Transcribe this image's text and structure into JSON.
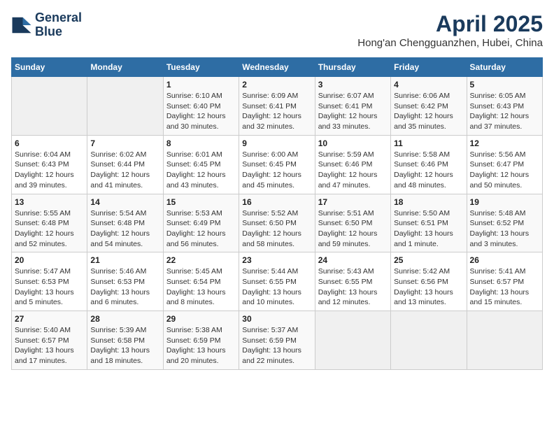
{
  "header": {
    "logo_line1": "General",
    "logo_line2": "Blue",
    "month": "April 2025",
    "location": "Hong'an Chengguanzhen, Hubei, China"
  },
  "days_of_week": [
    "Sunday",
    "Monday",
    "Tuesday",
    "Wednesday",
    "Thursday",
    "Friday",
    "Saturday"
  ],
  "weeks": [
    [
      {
        "day": "",
        "empty": true
      },
      {
        "day": "",
        "empty": true
      },
      {
        "day": "1",
        "info": "Sunrise: 6:10 AM\nSunset: 6:40 PM\nDaylight: 12 hours\nand 30 minutes."
      },
      {
        "day": "2",
        "info": "Sunrise: 6:09 AM\nSunset: 6:41 PM\nDaylight: 12 hours\nand 32 minutes."
      },
      {
        "day": "3",
        "info": "Sunrise: 6:07 AM\nSunset: 6:41 PM\nDaylight: 12 hours\nand 33 minutes."
      },
      {
        "day": "4",
        "info": "Sunrise: 6:06 AM\nSunset: 6:42 PM\nDaylight: 12 hours\nand 35 minutes."
      },
      {
        "day": "5",
        "info": "Sunrise: 6:05 AM\nSunset: 6:43 PM\nDaylight: 12 hours\nand 37 minutes."
      }
    ],
    [
      {
        "day": "6",
        "info": "Sunrise: 6:04 AM\nSunset: 6:43 PM\nDaylight: 12 hours\nand 39 minutes."
      },
      {
        "day": "7",
        "info": "Sunrise: 6:02 AM\nSunset: 6:44 PM\nDaylight: 12 hours\nand 41 minutes."
      },
      {
        "day": "8",
        "info": "Sunrise: 6:01 AM\nSunset: 6:45 PM\nDaylight: 12 hours\nand 43 minutes."
      },
      {
        "day": "9",
        "info": "Sunrise: 6:00 AM\nSunset: 6:45 PM\nDaylight: 12 hours\nand 45 minutes."
      },
      {
        "day": "10",
        "info": "Sunrise: 5:59 AM\nSunset: 6:46 PM\nDaylight: 12 hours\nand 47 minutes."
      },
      {
        "day": "11",
        "info": "Sunrise: 5:58 AM\nSunset: 6:46 PM\nDaylight: 12 hours\nand 48 minutes."
      },
      {
        "day": "12",
        "info": "Sunrise: 5:56 AM\nSunset: 6:47 PM\nDaylight: 12 hours\nand 50 minutes."
      }
    ],
    [
      {
        "day": "13",
        "info": "Sunrise: 5:55 AM\nSunset: 6:48 PM\nDaylight: 12 hours\nand 52 minutes."
      },
      {
        "day": "14",
        "info": "Sunrise: 5:54 AM\nSunset: 6:48 PM\nDaylight: 12 hours\nand 54 minutes."
      },
      {
        "day": "15",
        "info": "Sunrise: 5:53 AM\nSunset: 6:49 PM\nDaylight: 12 hours\nand 56 minutes."
      },
      {
        "day": "16",
        "info": "Sunrise: 5:52 AM\nSunset: 6:50 PM\nDaylight: 12 hours\nand 58 minutes."
      },
      {
        "day": "17",
        "info": "Sunrise: 5:51 AM\nSunset: 6:50 PM\nDaylight: 12 hours\nand 59 minutes."
      },
      {
        "day": "18",
        "info": "Sunrise: 5:50 AM\nSunset: 6:51 PM\nDaylight: 13 hours\nand 1 minute."
      },
      {
        "day": "19",
        "info": "Sunrise: 5:48 AM\nSunset: 6:52 PM\nDaylight: 13 hours\nand 3 minutes."
      }
    ],
    [
      {
        "day": "20",
        "info": "Sunrise: 5:47 AM\nSunset: 6:53 PM\nDaylight: 13 hours\nand 5 minutes."
      },
      {
        "day": "21",
        "info": "Sunrise: 5:46 AM\nSunset: 6:53 PM\nDaylight: 13 hours\nand 6 minutes."
      },
      {
        "day": "22",
        "info": "Sunrise: 5:45 AM\nSunset: 6:54 PM\nDaylight: 13 hours\nand 8 minutes."
      },
      {
        "day": "23",
        "info": "Sunrise: 5:44 AM\nSunset: 6:55 PM\nDaylight: 13 hours\nand 10 minutes."
      },
      {
        "day": "24",
        "info": "Sunrise: 5:43 AM\nSunset: 6:55 PM\nDaylight: 13 hours\nand 12 minutes."
      },
      {
        "day": "25",
        "info": "Sunrise: 5:42 AM\nSunset: 6:56 PM\nDaylight: 13 hours\nand 13 minutes."
      },
      {
        "day": "26",
        "info": "Sunrise: 5:41 AM\nSunset: 6:57 PM\nDaylight: 13 hours\nand 15 minutes."
      }
    ],
    [
      {
        "day": "27",
        "info": "Sunrise: 5:40 AM\nSunset: 6:57 PM\nDaylight: 13 hours\nand 17 minutes."
      },
      {
        "day": "28",
        "info": "Sunrise: 5:39 AM\nSunset: 6:58 PM\nDaylight: 13 hours\nand 18 minutes."
      },
      {
        "day": "29",
        "info": "Sunrise: 5:38 AM\nSunset: 6:59 PM\nDaylight: 13 hours\nand 20 minutes."
      },
      {
        "day": "30",
        "info": "Sunrise: 5:37 AM\nSunset: 6:59 PM\nDaylight: 13 hours\nand 22 minutes."
      },
      {
        "day": "",
        "empty": true
      },
      {
        "day": "",
        "empty": true
      },
      {
        "day": "",
        "empty": true
      }
    ]
  ]
}
